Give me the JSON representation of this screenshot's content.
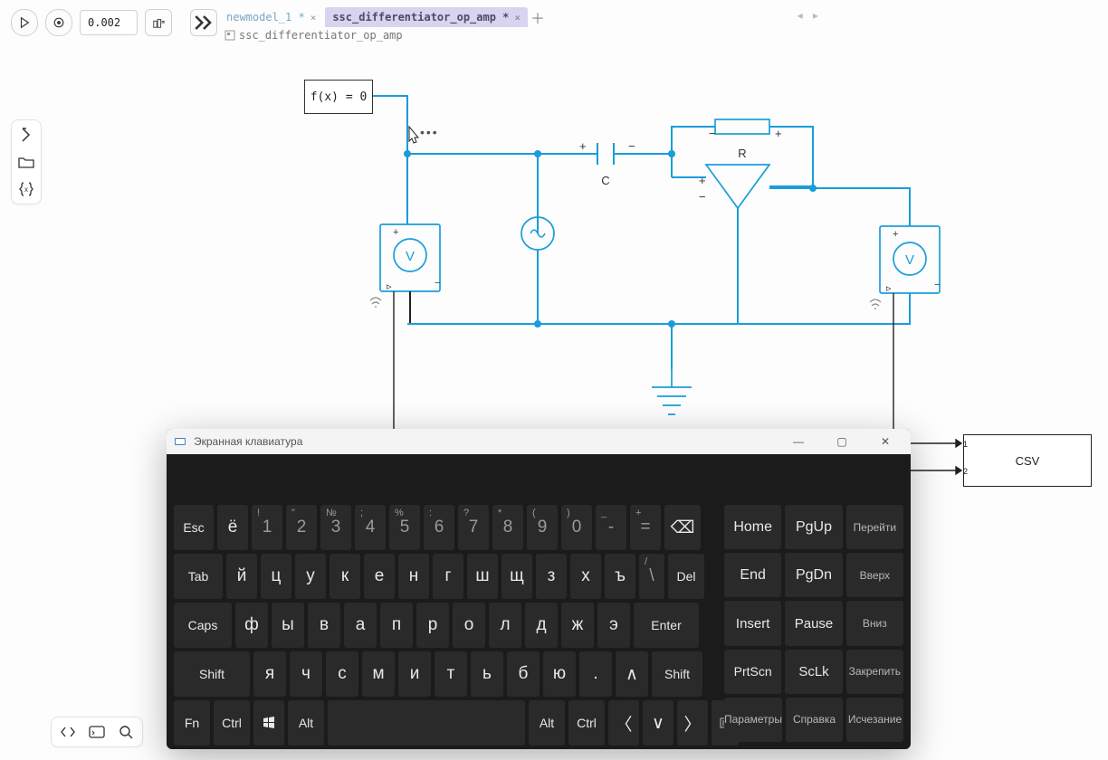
{
  "toolbar": {
    "step_value": "0.002"
  },
  "tabs": {
    "items": [
      {
        "label": "newmodel_1 *",
        "active": false
      },
      {
        "label": "ssc_differentiator_op_amp *",
        "active": true
      }
    ]
  },
  "breadcrumb": {
    "path": "ssc_differentiator_op_amp"
  },
  "solver": {
    "label": "f(x) = 0"
  },
  "circuit": {
    "c_label": "C",
    "r_label": "R",
    "plus": "+",
    "minus": "−"
  },
  "csv": {
    "label": "CSV",
    "port1": "1",
    "port2": "2"
  },
  "osk": {
    "title": "Экранная клавиатура",
    "rows": {
      "r1": [
        "Esc",
        "ё",
        "1",
        "2",
        "3",
        "4",
        "5",
        "6",
        "7",
        "8",
        "9",
        "0",
        "-",
        "="
      ],
      "r1_sup": [
        "",
        "",
        "!",
        "\"",
        "№",
        ";",
        "%",
        ":",
        "?",
        "*",
        "(",
        ")",
        "_",
        "+"
      ],
      "r2": [
        "Tab",
        "й",
        "ц",
        "у",
        "к",
        "е",
        "н",
        "г",
        "ш",
        "щ",
        "з",
        "х",
        "ъ",
        "\\",
        "Del"
      ],
      "r2_sup_slash": "/",
      "r3": [
        "Caps",
        "ф",
        "ы",
        "в",
        "а",
        "п",
        "р",
        "о",
        "л",
        "д",
        "ж",
        "э",
        "Enter"
      ],
      "r4": [
        "Shift",
        "я",
        "ч",
        "с",
        "м",
        "и",
        "т",
        "ь",
        "б",
        "ю",
        ".",
        "↑",
        "Shift"
      ],
      "r5": [
        "Fn",
        "Ctrl",
        "⊞",
        "Alt",
        " ",
        "Alt",
        "Ctrl",
        "←",
        "↓",
        "→",
        "☰"
      ]
    },
    "nav": {
      "r1": [
        "Home",
        "PgUp",
        "Перейти"
      ],
      "r2": [
        "End",
        "PgDn",
        "Вверх"
      ],
      "r3": [
        "Insert",
        "Pause",
        "Вниз"
      ],
      "r4": [
        "PrtScn",
        "ScLk",
        "Закрепить"
      ],
      "r5": [
        "Параметры",
        "Справка",
        "Исчезание"
      ]
    }
  }
}
